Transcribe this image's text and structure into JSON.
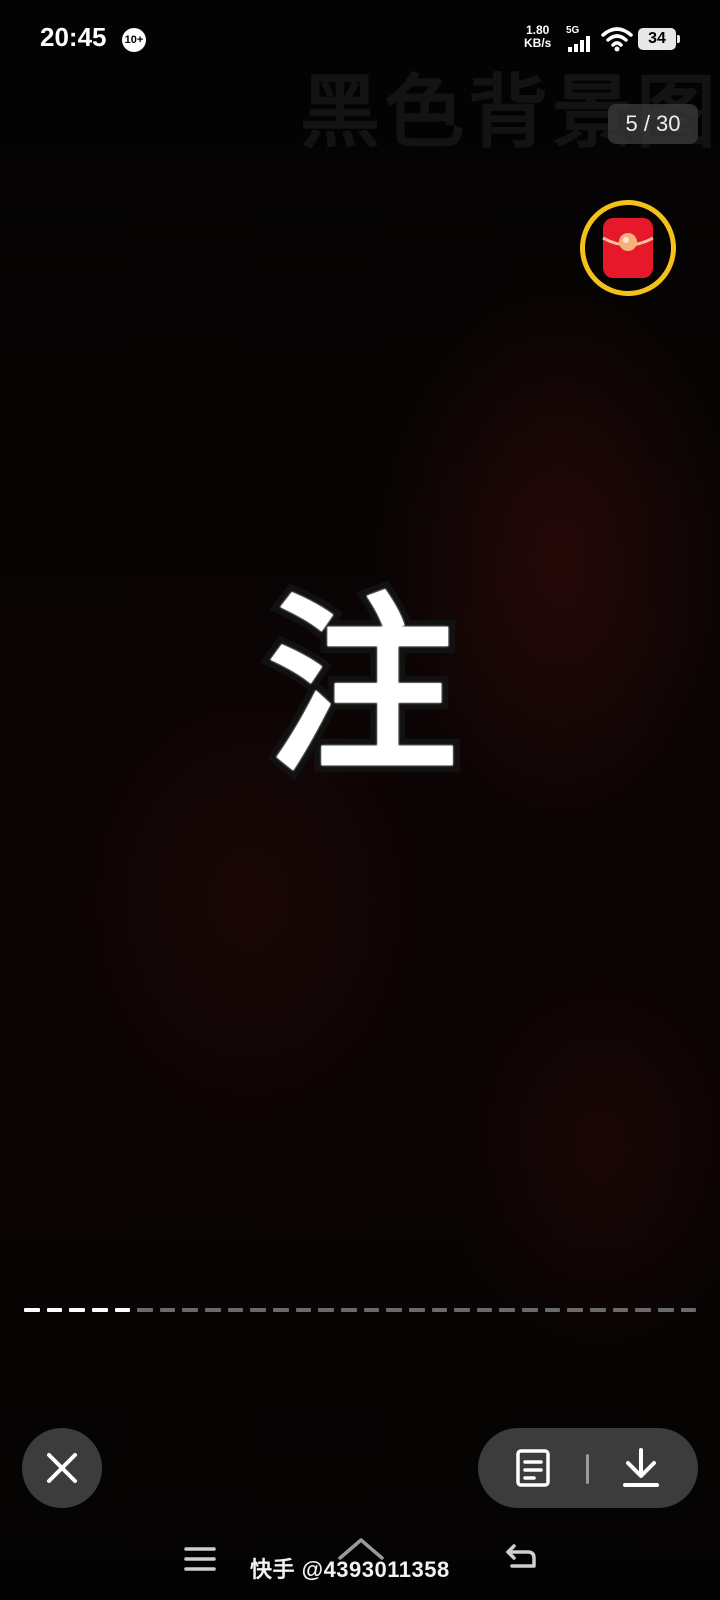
{
  "status_bar": {
    "time": "20:45",
    "notification_badge": "10+",
    "net_speed_value": "1.80",
    "net_speed_unit": "KB/s",
    "signal_label": "5G",
    "battery": "34"
  },
  "background": {
    "watermark_text": "黑色背景图"
  },
  "viewer": {
    "page_counter": "5 / 30",
    "center_character": "注",
    "current_index": 5,
    "total_pages": 30
  },
  "toolbar": {
    "close_icon": "close-icon",
    "text_icon": "document-text-icon",
    "download_icon": "download-icon"
  },
  "navbar": {
    "source_label": "快手 @4393011358"
  },
  "colors": {
    "redpacket_ring": "#f2c21b",
    "redpacket_body": "#e8182b",
    "progress_active": "#ffffff",
    "progress_inactive": "#6a6a6a"
  }
}
